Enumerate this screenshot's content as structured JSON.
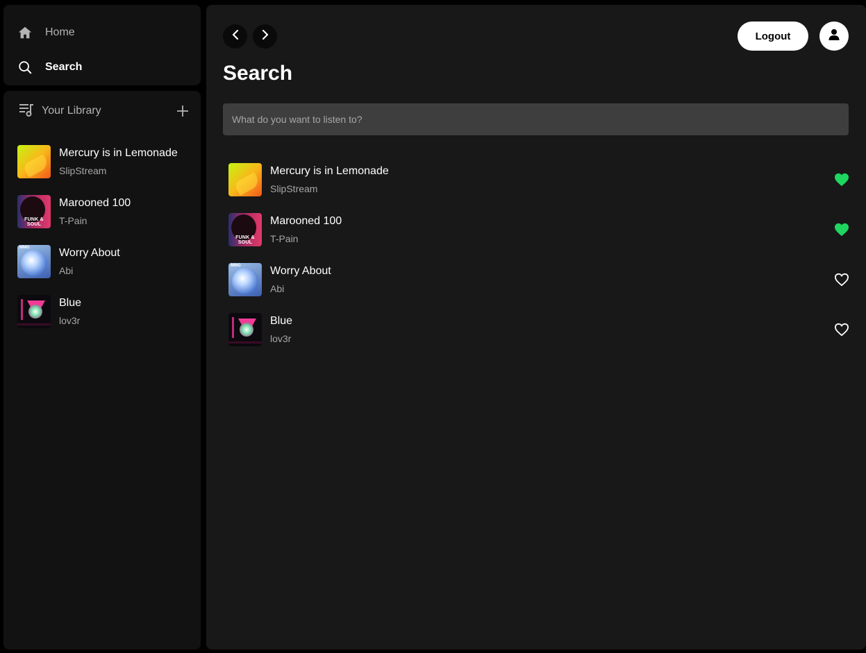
{
  "nav": {
    "home_label": "Home",
    "search_label": "Search"
  },
  "library": {
    "title": "Your Library",
    "items": [
      {
        "title": "Mercury is in Lemonade",
        "artist": "SlipStream"
      },
      {
        "title": "Marooned 100",
        "artist": "T-Pain"
      },
      {
        "title": "Worry About",
        "artist": "Abi"
      },
      {
        "title": "Blue",
        "artist": "lov3r"
      }
    ]
  },
  "header": {
    "logout_label": "Logout"
  },
  "page": {
    "title": "Search"
  },
  "search": {
    "placeholder": "What do you want to listen to?",
    "value": ""
  },
  "covers": {
    "marooned_caption": "FUNK & SOUL",
    "worry_caption": "MMG"
  },
  "results": [
    {
      "title": "Mercury is in Lemonade",
      "artist": "SlipStream",
      "liked": true
    },
    {
      "title": "Marooned 100",
      "artist": "T-Pain",
      "liked": true
    },
    {
      "title": "Worry About",
      "artist": "Abi",
      "liked": false
    },
    {
      "title": "Blue",
      "artist": "lov3r",
      "liked": false
    }
  ],
  "colors": {
    "accent": "#1ed760",
    "panel": "#121212",
    "main": "#181818",
    "input": "#3e3e3e"
  },
  "icons": [
    "home-icon",
    "search-icon",
    "library-icon",
    "plus-icon",
    "chevron-left-icon",
    "chevron-right-icon",
    "user-icon",
    "heart-filled-icon",
    "heart-outline-icon"
  ]
}
